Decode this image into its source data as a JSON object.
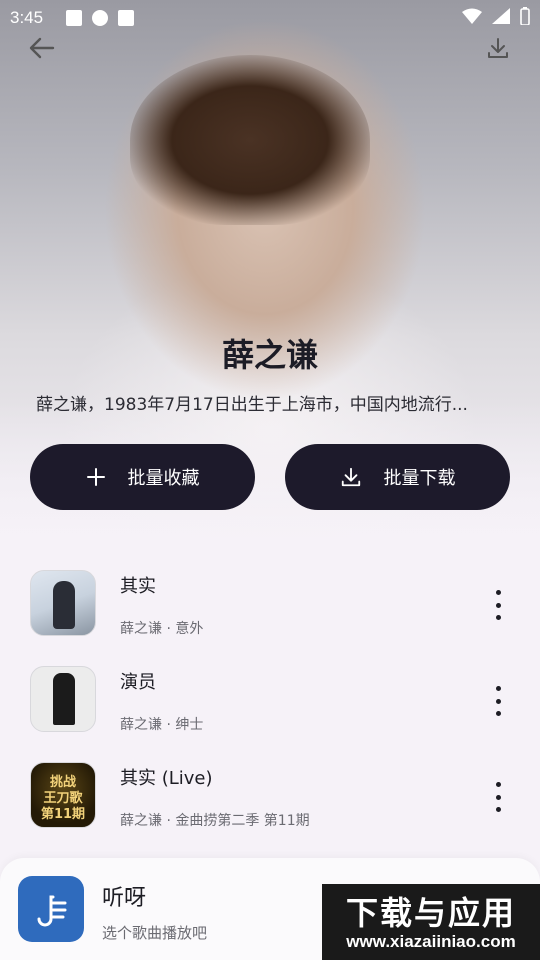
{
  "status_bar": {
    "time": "3:45"
  },
  "artist": {
    "name": "薛之谦",
    "bio": "薛之谦，1983年7月17日出生于上海市，中国内地流行..."
  },
  "actions": {
    "batch_favorite": "批量收藏",
    "batch_download": "批量下载"
  },
  "songs": [
    {
      "title": "其实",
      "subtitle": "薛之谦 · 意外"
    },
    {
      "title": "演员",
      "subtitle": "薛之谦 · 绅士"
    },
    {
      "title": "其实 (Live)",
      "subtitle": "薛之谦 · 金曲捞第二季 第11期"
    }
  ],
  "covers": {
    "c3_text": "挑战\n王刀歌\n第11期"
  },
  "player": {
    "title": "听呀",
    "subtitle": "选个歌曲播放吧"
  },
  "watermark": {
    "line1": "下载与应用",
    "line2": "www.xiazaiiniao.com"
  }
}
